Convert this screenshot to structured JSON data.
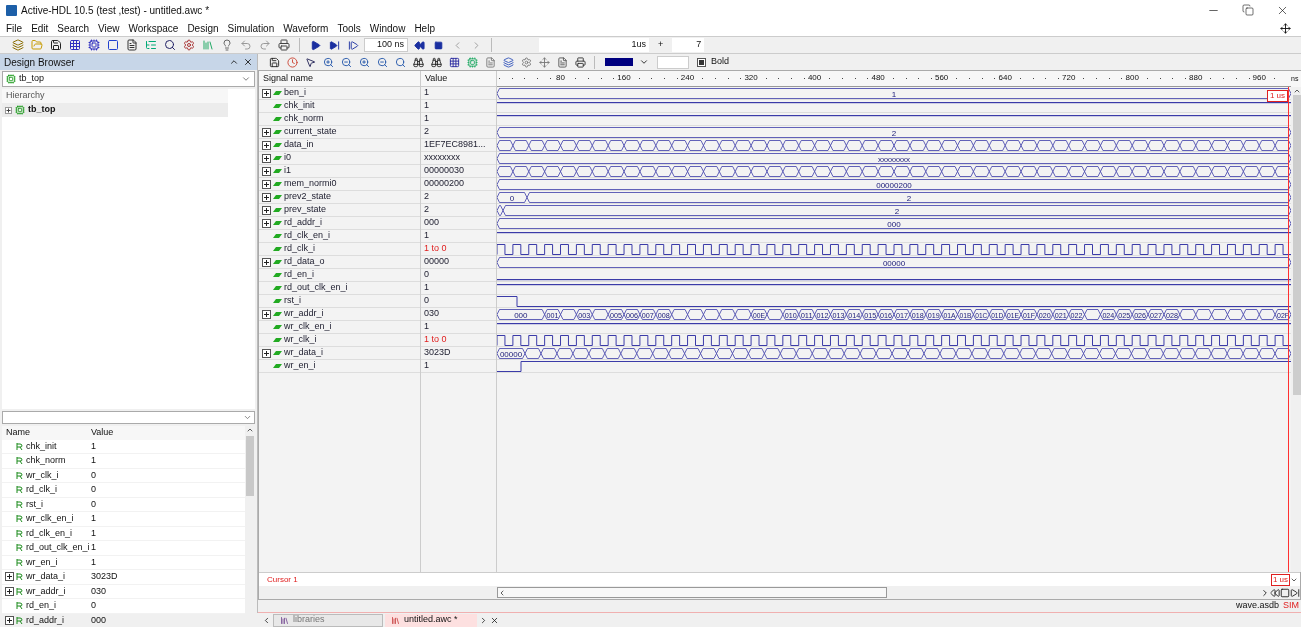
{
  "window": {
    "title": "Active-HDL 10.5 (test ,test) - untitled.awc *"
  },
  "menu": [
    "File",
    "Edit",
    "Search",
    "View",
    "Workspace",
    "Design",
    "Simulation",
    "Waveform",
    "Tools",
    "Window",
    "Help"
  ],
  "toolbar": {
    "step_time": "100 ns",
    "run_until": "1us",
    "plus": "+",
    "count": "7"
  },
  "wave_toolbar": {
    "bold_label": "Bold",
    "bold_checked": true
  },
  "design_browser": {
    "title": "Design Browser",
    "top_unit": "tb_top",
    "hierarchy_header": "Hierarchy",
    "tree": [
      {
        "label": "tb_top",
        "expanded": false,
        "selected": true
      }
    ],
    "columns": [
      "Name",
      "Value"
    ],
    "objects": [
      {
        "name": "chk_init",
        "value": "1",
        "expandable": false
      },
      {
        "name": "chk_norm",
        "value": "1",
        "expandable": false
      },
      {
        "name": "wr_clk_i",
        "value": "0",
        "expandable": false
      },
      {
        "name": "rd_clk_i",
        "value": "0",
        "expandable": false
      },
      {
        "name": "rst_i",
        "value": "0",
        "expandable": false
      },
      {
        "name": "wr_clk_en_i",
        "value": "1",
        "expandable": false
      },
      {
        "name": "rd_clk_en_i",
        "value": "1",
        "expandable": false
      },
      {
        "name": "rd_out_clk_en_i",
        "value": "1",
        "expandable": false
      },
      {
        "name": "wr_en_i",
        "value": "1",
        "expandable": false
      },
      {
        "name": "wr_data_i",
        "value": "3023D",
        "expandable": true
      },
      {
        "name": "wr_addr_i",
        "value": "030",
        "expandable": true
      },
      {
        "name": "rd_en_i",
        "value": "0",
        "expandable": false
      },
      {
        "name": "rd_addr_i",
        "value": "000",
        "expandable": true
      }
    ]
  },
  "waveform": {
    "columns": [
      "Signal name",
      "Value"
    ],
    "ruler": {
      "labels": [
        "80",
        "160",
        "240",
        "320",
        "400",
        "480",
        "560",
        "640",
        "720",
        "800",
        "880",
        "960"
      ],
      "unit": "ns"
    },
    "signals": [
      {
        "name": "ben_i",
        "value": "1",
        "expandable": true,
        "changing": false,
        "wave": {
          "kind": "bus",
          "labels": [
            "1"
          ]
        }
      },
      {
        "name": "chk_init",
        "value": "1",
        "expandable": false,
        "changing": false,
        "wave": {
          "kind": "bit",
          "high": true
        }
      },
      {
        "name": "chk_norm",
        "value": "1",
        "expandable": false,
        "changing": false,
        "wave": {
          "kind": "bit",
          "high": true
        }
      },
      {
        "name": "current_state",
        "value": "2",
        "expandable": true,
        "changing": false,
        "wave": {
          "kind": "bus",
          "labels": [
            "2"
          ]
        }
      },
      {
        "name": "data_in",
        "value": "1EF7EC8981...",
        "expandable": true,
        "changing": false,
        "wave": {
          "kind": "toggle"
        }
      },
      {
        "name": "i0",
        "value": "xxxxxxxx",
        "expandable": true,
        "changing": false,
        "wave": {
          "kind": "bus",
          "labels": [
            "xxxxxxxx"
          ]
        }
      },
      {
        "name": "i1",
        "value": "00000030",
        "expandable": true,
        "changing": false,
        "wave": {
          "kind": "toggle"
        }
      },
      {
        "name": "mem_normi0",
        "value": "00000200",
        "expandable": true,
        "changing": false,
        "wave": {
          "kind": "bus",
          "labels": [
            "00000200"
          ]
        }
      },
      {
        "name": "prev2_state",
        "value": "2",
        "expandable": true,
        "changing": false,
        "wave": {
          "kind": "bus",
          "segments": [
            {
              "kind": "labeled",
              "label": "0"
            },
            {
              "kind": "labeled",
              "label": "2"
            }
          ]
        }
      },
      {
        "name": "prev_state",
        "value": "2",
        "expandable": true,
        "changing": false,
        "wave": {
          "kind": "bus",
          "segments": [
            {
              "kind": "blank"
            },
            {
              "kind": "labeled",
              "label": "2"
            }
          ]
        }
      },
      {
        "name": "rd_addr_i",
        "value": "000",
        "expandable": true,
        "changing": false,
        "wave": {
          "kind": "bus",
          "labels": [
            "000"
          ]
        }
      },
      {
        "name": "rd_clk_en_i",
        "value": "1",
        "expandable": false,
        "changing": false,
        "wave": {
          "kind": "bit",
          "high": true
        }
      },
      {
        "name": "rd_clk_i",
        "value": "1 to 0",
        "expandable": false,
        "changing": true,
        "wave": {
          "kind": "clock"
        }
      },
      {
        "name": "rd_data_o",
        "value": "00000",
        "expandable": true,
        "changing": false,
        "wave": {
          "kind": "bus",
          "labels": [
            "00000"
          ]
        }
      },
      {
        "name": "rd_en_i",
        "value": "0",
        "expandable": false,
        "changing": false,
        "wave": {
          "kind": "bit",
          "high": false
        }
      },
      {
        "name": "rd_out_clk_en_i",
        "value": "1",
        "expandable": false,
        "changing": false,
        "wave": {
          "kind": "bit",
          "high": true
        }
      },
      {
        "name": "rst_i",
        "value": "0",
        "expandable": false,
        "changing": false,
        "wave": {
          "kind": "step",
          "high": true
        }
      },
      {
        "name": "wr_addr_i",
        "value": "030",
        "expandable": true,
        "changing": false,
        "wave": {
          "kind": "counter",
          "segments": [
            {
              "kind": "labeled",
              "label": "000"
            },
            {
              "kind": "labeled",
              "label": "001"
            },
            {
              "kind": "blank"
            },
            {
              "kind": "labeled",
              "label": "003"
            },
            {
              "kind": "blank"
            },
            {
              "kind": "labeled",
              "label": "005"
            },
            {
              "kind": "labeled",
              "label": "006"
            },
            {
              "kind": "labeled",
              "label": "007"
            },
            {
              "kind": "labeled",
              "label": "008"
            },
            {
              "kind": "blank"
            },
            {
              "kind": "blank"
            },
            {
              "kind": "blank"
            },
            {
              "kind": "blank"
            },
            {
              "kind": "blank"
            },
            {
              "kind": "labeled",
              "label": "00E"
            },
            {
              "kind": "blank"
            },
            {
              "kind": "labeled",
              "label": "010"
            },
            {
              "kind": "labeled",
              "label": "011"
            },
            {
              "kind": "labeled",
              "label": "012"
            },
            {
              "kind": "labeled",
              "label": "013"
            },
            {
              "kind": "labeled",
              "label": "014"
            },
            {
              "kind": "labeled",
              "label": "015"
            },
            {
              "kind": "labeled",
              "label": "016"
            },
            {
              "kind": "labeled",
              "label": "017"
            },
            {
              "kind": "labeled",
              "label": "018"
            },
            {
              "kind": "labeled",
              "label": "019"
            },
            {
              "kind": "labeled",
              "label": "01A"
            },
            {
              "kind": "labeled",
              "label": "01B"
            },
            {
              "kind": "labeled",
              "label": "01C"
            },
            {
              "kind": "labeled",
              "label": "01D"
            },
            {
              "kind": "labeled",
              "label": "01E"
            },
            {
              "kind": "labeled",
              "label": "01F"
            },
            {
              "kind": "labeled",
              "label": "020"
            },
            {
              "kind": "labeled",
              "label": "021"
            },
            {
              "kind": "labeled",
              "label": "022"
            },
            {
              "kind": "blank"
            },
            {
              "kind": "labeled",
              "label": "024"
            },
            {
              "kind": "labeled",
              "label": "025"
            },
            {
              "kind": "labeled",
              "label": "026"
            },
            {
              "kind": "labeled",
              "label": "027"
            },
            {
              "kind": "labeled",
              "label": "028"
            },
            {
              "kind": "blank"
            },
            {
              "kind": "blank"
            },
            {
              "kind": "blank"
            },
            {
              "kind": "blank"
            },
            {
              "kind": "blank"
            },
            {
              "kind": "blank"
            },
            {
              "kind": "labeled",
              "label": "02F"
            }
          ]
        }
      },
      {
        "name": "wr_clk_en_i",
        "value": "1",
        "expandable": false,
        "changing": false,
        "wave": {
          "kind": "bit",
          "high": true
        }
      },
      {
        "name": "wr_clk_i",
        "value": "1 to 0",
        "expandable": false,
        "changing": true,
        "wave": {
          "kind": "clock"
        }
      },
      {
        "name": "wr_data_i",
        "value": "3023D",
        "expandable": true,
        "changing": false,
        "wave": {
          "kind": "toggle",
          "first_label": "00000"
        }
      },
      {
        "name": "wr_en_i",
        "value": "1",
        "expandable": false,
        "changing": false,
        "wave": {
          "kind": "step",
          "high": false
        }
      }
    ],
    "cursor": {
      "label": "Cursor 1",
      "time": "1 us",
      "bottom_time": "1 us"
    }
  },
  "status_bar": {
    "file": "wave.asdb",
    "mode": "SIM"
  },
  "tabs": [
    {
      "label": "libraries",
      "selected": false
    },
    {
      "label": "untitled.awc *",
      "selected": true
    }
  ]
}
